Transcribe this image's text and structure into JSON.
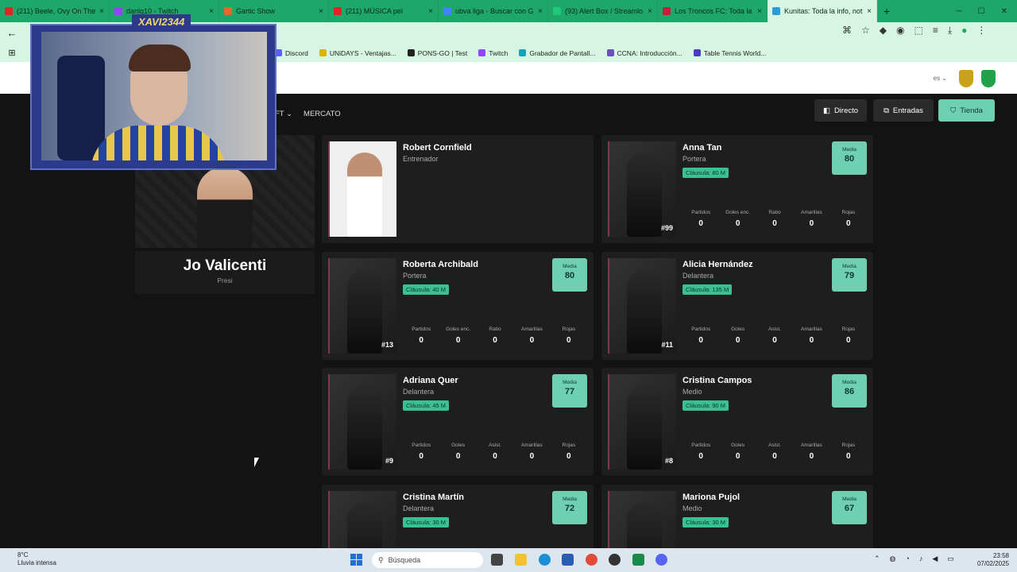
{
  "tabs": [
    {
      "title": "(211) Beele, Ovy On The",
      "color": "#e02424"
    },
    {
      "title": "danlg10 - Twitch",
      "color": "#9146ff"
    },
    {
      "title": "Gartic Show",
      "color": "#e36b2a"
    },
    {
      "title": "(211) MÚSICA pel",
      "color": "#e02424"
    },
    {
      "title": "ubva liga - Buscar con G",
      "color": "#4285f4"
    },
    {
      "title": "(93) Alert Box / Streamlo",
      "color": "#20c97a"
    },
    {
      "title": "Los Troncos FC: Toda la",
      "color": "#c21f3a"
    },
    {
      "title": "Kunitas: Toda la info, not",
      "color": "#2a9cd7"
    }
  ],
  "bookmarks": [
    {
      "label": "Discord",
      "color": "#5865f2"
    },
    {
      "label": "UNiDAYS - Ventajas...",
      "color": "#d9b400"
    },
    {
      "label": "PONS-GO | Test",
      "color": "#222"
    },
    {
      "label": "Twitch",
      "color": "#9146ff"
    },
    {
      "label": "Grabador de Pantall...",
      "color": "#17a2b8"
    },
    {
      "label": "CCNA: Introducción...",
      "color": "#6b4fbb"
    },
    {
      "label": "Table Tennis World...",
      "color": "#4c3cc4"
    }
  ],
  "header": {
    "lang": "es ⌄",
    "menu": [
      "FT ⌄",
      "MERCATO"
    ],
    "buttons": {
      "directo": "Directo",
      "entradas": "Entradas",
      "tienda": "Tienda"
    }
  },
  "president": {
    "name": "Jo Valicenti",
    "role": "Presi"
  },
  "coach": {
    "name": "Robert Cornfield",
    "role": "Entrenador"
  },
  "players": [
    {
      "name": "Anna Tan",
      "position": "Portera",
      "clause": "Cláusula: 80 M",
      "media": "80",
      "number": "#99",
      "stat_labels": [
        "Partidos",
        "Goles enc.",
        "Ratio",
        "Amarillas",
        "Rojas"
      ],
      "stat_values": [
        "0",
        "0",
        "0",
        "0",
        "0"
      ]
    },
    {
      "name": "Roberta Archibald",
      "position": "Portera",
      "clause": "Cláusula: 40 M",
      "media": "80",
      "number": "#13",
      "stat_labels": [
        "Partidos",
        "Goles enc.",
        "Ratio",
        "Amarillas",
        "Rojas"
      ],
      "stat_values": [
        "0",
        "0",
        "0",
        "0",
        "0"
      ]
    },
    {
      "name": "Alicia Hernández",
      "position": "Delantera",
      "clause": "Cláusula: 135 M",
      "media": "79",
      "number": "#11",
      "stat_labels": [
        "Partidos",
        "Goles",
        "Asist.",
        "Amarillas",
        "Rojas"
      ],
      "stat_values": [
        "0",
        "0",
        "0",
        "0",
        "0"
      ]
    },
    {
      "name": "Adriana Quer",
      "position": "Delantera",
      "clause": "Cláusula: 45 M",
      "media": "77",
      "number": "#9",
      "stat_labels": [
        "Partidos",
        "Goles",
        "Asist.",
        "Amarillas",
        "Rojas"
      ],
      "stat_values": [
        "0",
        "0",
        "0",
        "0",
        "0"
      ]
    },
    {
      "name": "Cristina Campos",
      "position": "Medio",
      "clause": "Cláusula: 90 M",
      "media": "86",
      "number": "#8",
      "stat_labels": [
        "Partidos",
        "Goles",
        "Asist.",
        "Amarillas",
        "Rojas"
      ],
      "stat_values": [
        "0",
        "0",
        "0",
        "0",
        "0"
      ]
    },
    {
      "name": "Cristina Martín",
      "position": "Delantera",
      "clause": "Cláusula: 30 M",
      "media": "72",
      "number": "",
      "stat_labels": [],
      "stat_values": []
    },
    {
      "name": "Mariona Pujol",
      "position": "Medio",
      "clause": "Cláusula: 30 M",
      "media": "67",
      "number": "",
      "stat_labels": [],
      "stat_values": []
    }
  ],
  "media_label": "Media",
  "webcam": {
    "title": "XAVI2344"
  },
  "taskbar": {
    "temp": "8°C",
    "weather": "Lluvia intensa",
    "search": "Búsqueda",
    "time": "23:58",
    "date": "07/02/2025"
  },
  "colors": {
    "browser_accent": "#1ea66b",
    "tienda": "#6fcfb1",
    "clause": "#3ac095"
  }
}
